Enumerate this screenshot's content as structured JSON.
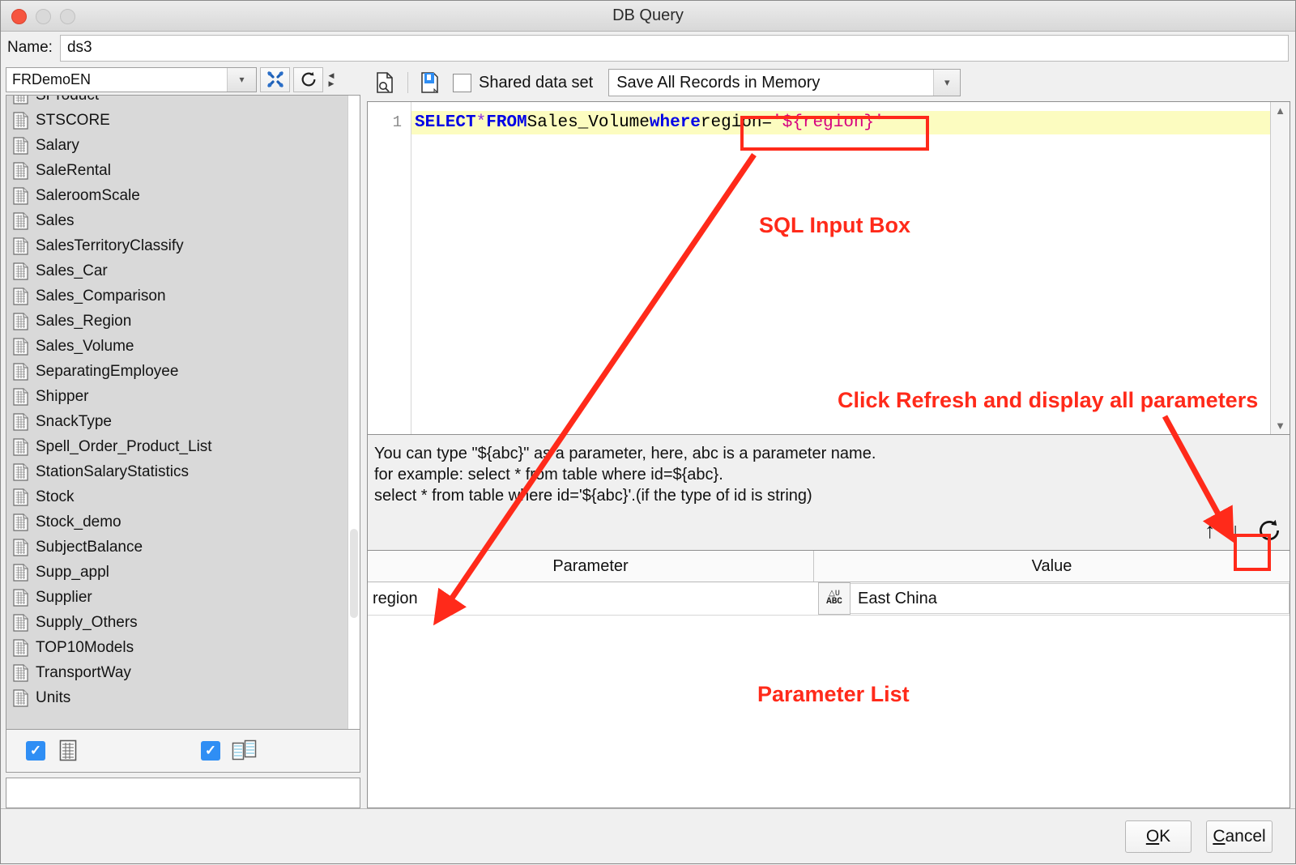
{
  "window": {
    "title": "DB Query",
    "traffic_lights": [
      "close",
      "minimize",
      "maximize"
    ]
  },
  "name_row": {
    "label": "Name:",
    "value": "ds3",
    "placeholder": ""
  },
  "left_panel": {
    "datasource": {
      "value": "FRDemoEN",
      "dropdown_icon": "chevron-down-icon"
    },
    "tools_button_icon": "wrench-tools-icon",
    "refresh_button_icon": "refresh-icon",
    "table_list": [
      "SProduct",
      "STSCORE",
      "Salary",
      "SaleRental",
      "SaleroomScale",
      "Sales",
      "SalesTerritoryClassify",
      "Sales_Car",
      "Sales_Comparison",
      "Sales_Region",
      "Sales_Volume",
      "SeparatingEmployee",
      "Shipper",
      "SnackType",
      "Spell_Order_Product_List",
      "StationSalaryStatistics",
      "Stock",
      "Stock_demo",
      "SubjectBalance",
      "Supp_appl",
      "Supplier",
      "Supply_Others",
      "TOP10Models",
      "TransportWay",
      "Units"
    ],
    "filters": [
      {
        "checked": true,
        "icon": "table-icon",
        "label": ""
      },
      {
        "checked": true,
        "icon": "views-icon",
        "label": ""
      }
    ],
    "search_value": ""
  },
  "right_panel": {
    "toolbar": {
      "preview_icon": "preview-document-icon",
      "save_icon": "save-document-icon",
      "shared_dataset": {
        "label": "Shared data set",
        "checked": false
      },
      "memory_mode": {
        "value": "Save All Records in Memory",
        "dropdown_icon": "chevron-down-icon"
      }
    },
    "sql_editor": {
      "line_number": "1",
      "tokens": [
        {
          "text": "SELECT",
          "type": "keyword"
        },
        {
          "text": " ",
          "type": "plain"
        },
        {
          "text": "*",
          "type": "star"
        },
        {
          "text": " ",
          "type": "plain"
        },
        {
          "text": "FROM",
          "type": "keyword"
        },
        {
          "text": " Sales_Volume ",
          "type": "ident"
        },
        {
          "text": "where",
          "type": "keyword"
        },
        {
          "text": " region=",
          "type": "ident"
        },
        {
          "text": "'${region}'",
          "type": "param"
        }
      ],
      "full_text": "SELECT * FROM Sales_Volume where region='${region}'",
      "scroll_up_icon": "chevron-up-icon",
      "scroll_down_icon": "chevron-down-icon"
    },
    "hint_lines": [
      "You can type \"${abc}\" as a parameter, here, abc is a parameter name.",
      "for example: select * from table where id=${abc}.",
      "select * from table where id='${abc}'.(if the type of id is string)"
    ],
    "param_toolbar": {
      "move_up_icon": "arrow-up-icon",
      "move_down_icon": "arrow-down-icon",
      "refresh_icon": "refresh-icon"
    },
    "param_table": {
      "columns": [
        "Parameter",
        "Value"
      ],
      "rows": [
        {
          "parameter": "region",
          "type_icon": "abc-type-icon",
          "value": "East China"
        }
      ]
    }
  },
  "dialog_buttons": [
    {
      "id": "ok",
      "label": "OK",
      "mnemonic": "O"
    },
    {
      "id": "cancel",
      "label": "Cancel",
      "mnemonic": "C"
    }
  ],
  "annotations": {
    "color": "#ff2a1a",
    "sql_input_box": "SQL Input Box",
    "click_refresh": "Click Refresh and display all parameters",
    "parameter_list": "Parameter List"
  }
}
